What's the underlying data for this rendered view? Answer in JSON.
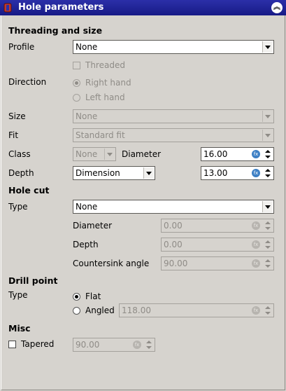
{
  "window": {
    "title": "Hole parameters",
    "icon": "cylinder-hole-icon",
    "collapse_icon": "chevron-up-icon",
    "title_bg": "#1f2395"
  },
  "threading": {
    "heading": "Threading and size",
    "profile_label": "Profile",
    "profile_value": "None",
    "threaded_label": "Threaded",
    "direction_label": "Direction",
    "right_hand_label": "Right hand",
    "left_hand_label": "Left hand",
    "size_label": "Size",
    "size_value": "None",
    "fit_label": "Fit",
    "fit_value": "Standard fit",
    "class_label": "Class",
    "class_value": "None",
    "diameter_label": "Diameter",
    "diameter_value": "16.00",
    "depth_label": "Depth",
    "depth_type": "Dimension",
    "depth_value": "13.00"
  },
  "hole_cut": {
    "heading": "Hole cut",
    "type_label": "Type",
    "type_value": "None",
    "diameter_label": "Diameter",
    "diameter_value": "0.00",
    "depth_label": "Depth",
    "depth_value": "0.00",
    "countersink_label": "Countersink angle",
    "countersink_value": "90.00"
  },
  "drill_point": {
    "heading": "Drill point",
    "type_label": "Type",
    "flat_label": "Flat",
    "angled_label": "Angled",
    "angled_value": "118.00"
  },
  "misc": {
    "heading": "Misc",
    "tapered_label": "Tapered",
    "tapered_value": "90.00"
  },
  "icons": {
    "expression": "fx",
    "expression_icon": "expression-fx-icon"
  }
}
